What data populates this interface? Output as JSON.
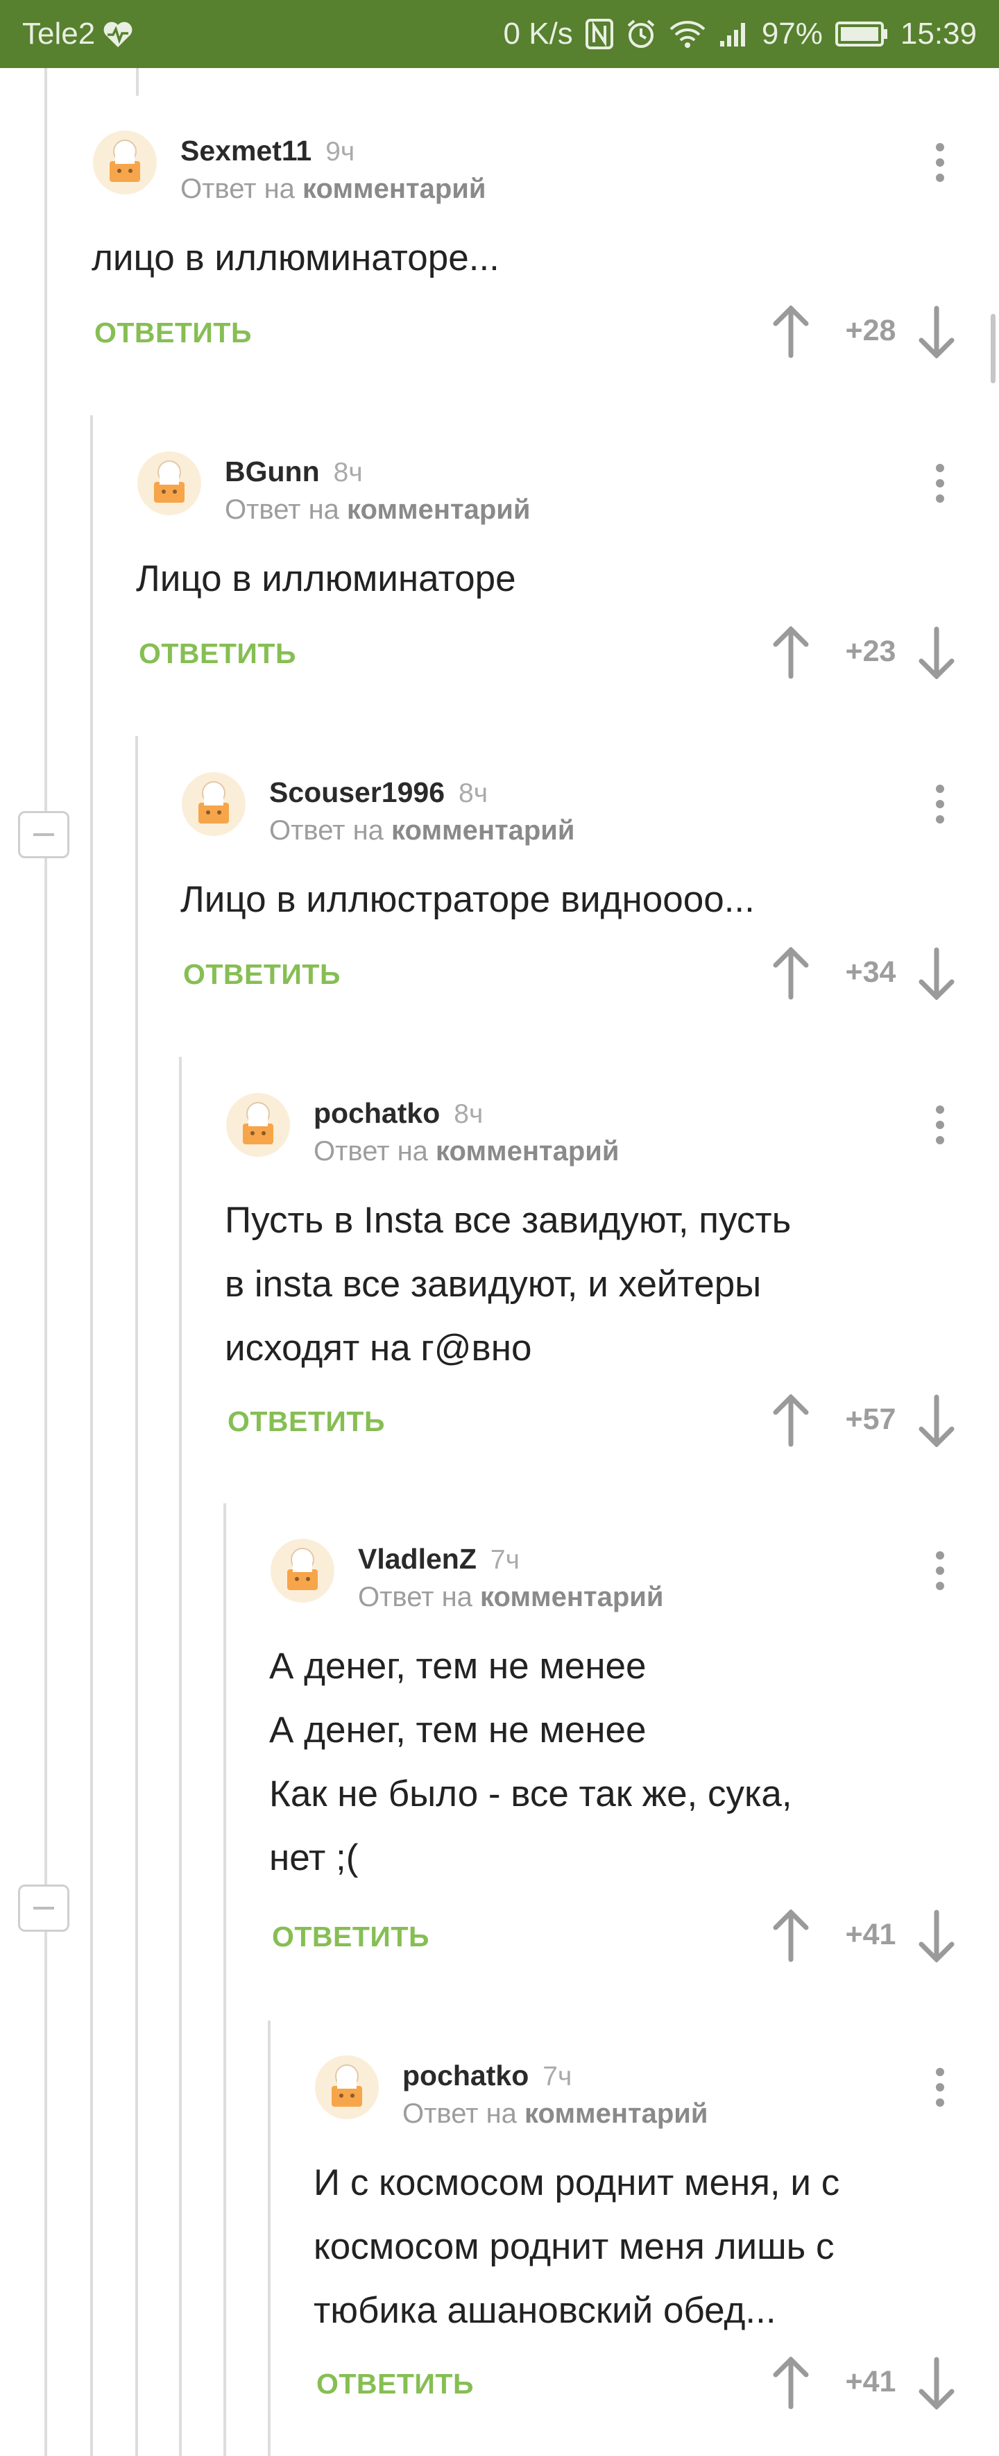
{
  "status_bar": {
    "carrier": "Tele2",
    "net_speed": "0 K/s",
    "battery": "97%",
    "time": "15:39"
  },
  "colors": {
    "status_bg": "#57802f",
    "reply_green": "#86be53"
  },
  "comments": [
    {
      "author": "Sexmet11",
      "time": "9ч",
      "reply_prefix": "Ответ на",
      "reply_target": "комментарий",
      "text": "лицо в иллюминаторе...",
      "reply_label": "ОТВЕТИТЬ",
      "score": "+28"
    },
    {
      "author": "BGunn",
      "time": "8ч",
      "reply_prefix": "Ответ на",
      "reply_target": "комментарий",
      "text": "Лицо в иллюминаторе",
      "reply_label": "ОТВЕТИТЬ",
      "score": "+23"
    },
    {
      "author": "Scouser1996",
      "time": "8ч",
      "reply_prefix": "Ответ на",
      "reply_target": "комментарий",
      "text": "Лицо в иллюстраторе видноооо...",
      "reply_label": "ОТВЕТИТЬ",
      "score": "+34"
    },
    {
      "author": "pochatko",
      "time": "8ч",
      "reply_prefix": "Ответ на",
      "reply_target": "комментарий",
      "text": "Пусть в Insta все завидуют, пусть\nв insta все завидуют, и хейтеры\nисходят на г@вно",
      "reply_label": "ОТВЕТИТЬ",
      "score": "+57"
    },
    {
      "author": "VladlenZ",
      "time": "7ч",
      "reply_prefix": "Ответ на",
      "reply_target": "комментарий",
      "text": "А денег, тем не менее\nА денег, тем не менее\nКак не было - все так же, сука,\nнет ;(",
      "reply_label": "ОТВЕТИТЬ",
      "score": "+41"
    },
    {
      "author": "pochatko",
      "time": "7ч",
      "reply_prefix": "Ответ на",
      "reply_target": "комментарий",
      "text": "И с космосом роднит меня, и с\nкосмосом роднит меня лишь с\nтюбика ашановский обед...",
      "reply_label": "ОТВЕТИТЬ",
      "score": "+41"
    }
  ]
}
